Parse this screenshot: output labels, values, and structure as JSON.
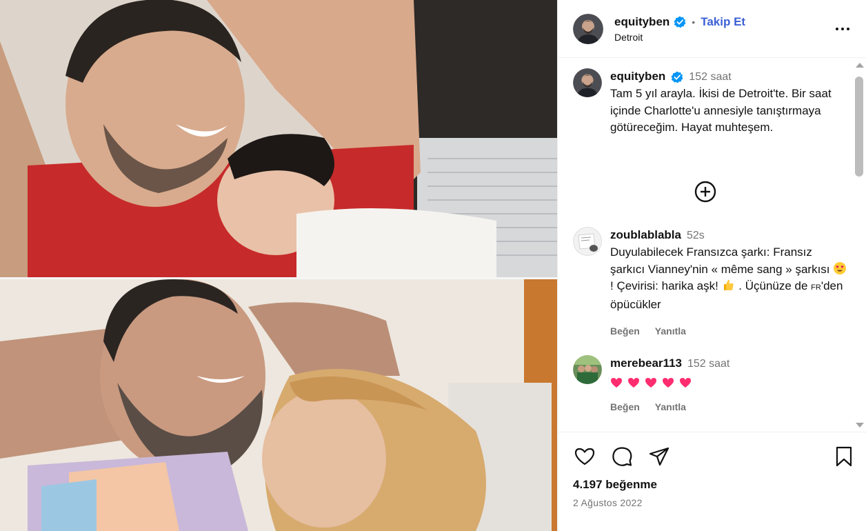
{
  "header": {
    "username": "equityben",
    "separator": "•",
    "follow_label": "Takip Et",
    "location": "Detroit",
    "more_icon": "more-horizontal-icon"
  },
  "caption": {
    "username": "equityben",
    "time": "152 saat",
    "text": "Tam 5 yıl arayla. İkisi de Detroit'te. Bir saat içinde Charlotte'u annesiyle tanıştırmaya götüreceğim. Hayat muhteşem."
  },
  "comments": [
    {
      "username": "zoublablabla",
      "time": "52s",
      "text_part1": "Duyulabilecek Fransızca şarkı: Fransız şarkıcı Vianney'nin « même sang » şarkısı ",
      "text_part2": " ! Çevirisi: harika aşk! ",
      "text_part3": " . Üçünüze de ",
      "flag_text": "FR",
      "text_part4": "'den öpücükler",
      "like_label": "Beğen",
      "reply_label": "Yanıtla"
    },
    {
      "username": "merebear113",
      "time": "152 saat",
      "hearts": 5,
      "like_label": "Beğen",
      "reply_label": "Yanıtla"
    }
  ],
  "footer": {
    "likes": "4.197 beğenme",
    "date": "2 Ağustos 2022"
  },
  "colors": {
    "accent": "#3b5fd4",
    "verified": "#0095f6",
    "muted": "#737373",
    "heart": "#ff2d6f"
  }
}
